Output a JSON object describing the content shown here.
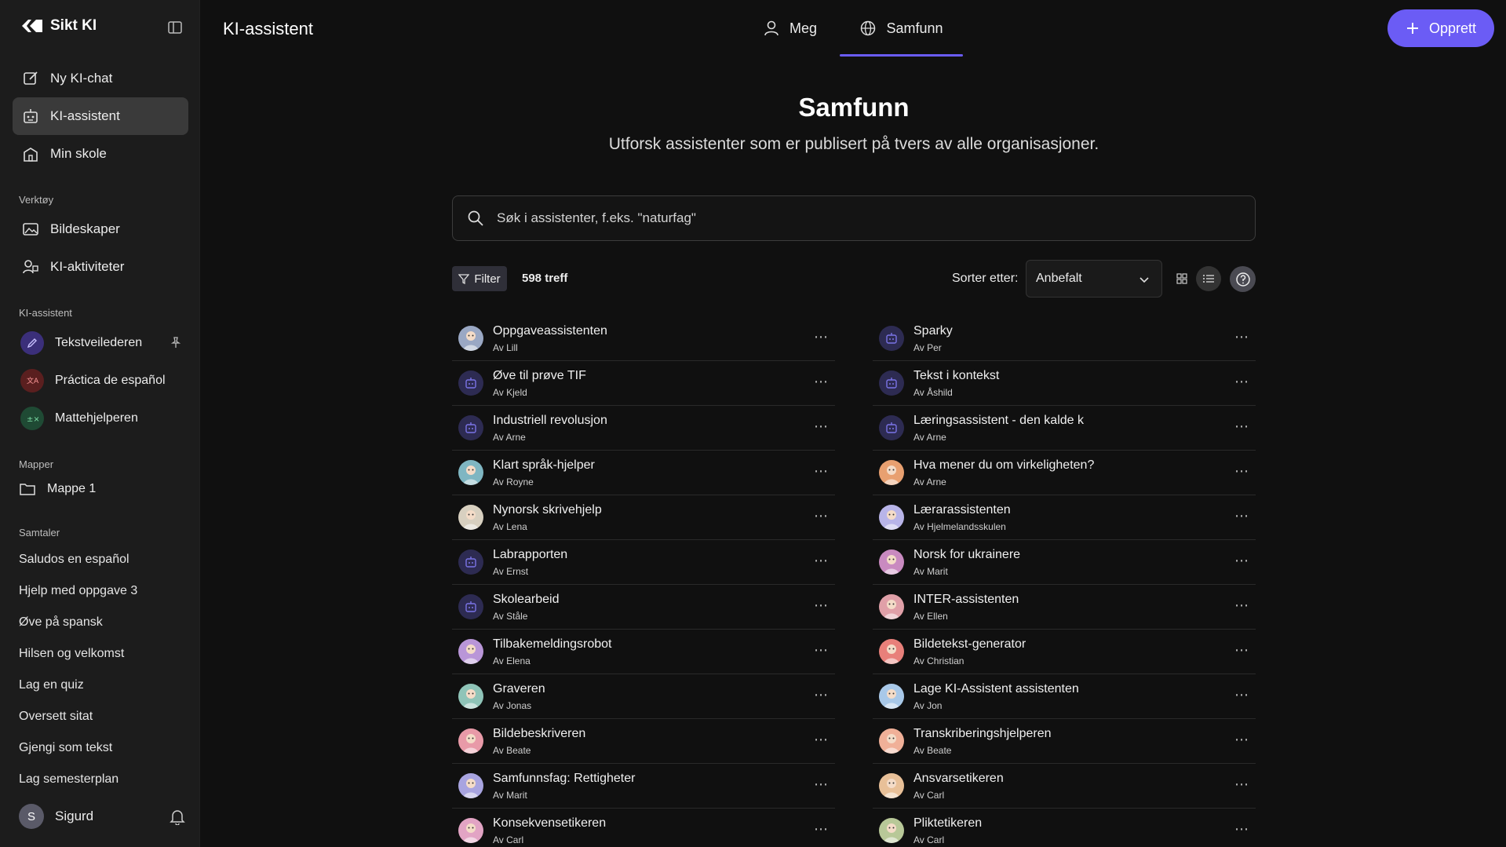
{
  "brand": {
    "name": "Sikt KI"
  },
  "header": {
    "title": "KI-assistent",
    "tabs": [
      {
        "label": "Meg"
      },
      {
        "label": "Samfunn"
      }
    ],
    "create_label": "Opprett"
  },
  "sidebar": {
    "nav": [
      {
        "label": "Ny KI-chat",
        "icon": "edit-icon"
      },
      {
        "label": "KI-assistent",
        "icon": "robot-icon"
      },
      {
        "label": "Min skole",
        "icon": "school-icon"
      }
    ],
    "tools_label": "Verktøy",
    "tools": [
      {
        "label": "Bildeskaper",
        "icon": "image-icon"
      },
      {
        "label": "KI-aktiviteter",
        "icon": "activities-icon"
      }
    ],
    "assistants_label": "KI-assistent",
    "assistants": [
      {
        "label": "Tekstveilederen",
        "color": "#3b2f7a"
      },
      {
        "label": "Práctica de español",
        "color": "#5a1f1f"
      },
      {
        "label": "Mattehjelperen",
        "color": "#1f4a34"
      }
    ],
    "folders_label": "Mapper",
    "folders": [
      {
        "label": "Mappe 1"
      }
    ],
    "chats_label": "Samtaler",
    "chats": [
      "Saludos en español",
      "Hjelp med oppgave 3",
      "Øve på spansk",
      "Hilsen og velkomst",
      "Lag en quiz",
      "Oversett sitat",
      "Gjengi som tekst",
      "Lag semesterplan"
    ],
    "user": {
      "initial": "S",
      "name": "Sigurd"
    }
  },
  "hero": {
    "title": "Samfunn",
    "subtitle": "Utforsk assistenter som er publisert på tvers av alle organisasjoner."
  },
  "search": {
    "placeholder": "Søk i assistenter, f.eks. \"naturfag\""
  },
  "toolbar": {
    "filter_label": "Filter",
    "count": "598 treff",
    "sort_label": "Sorter etter:",
    "sort_value": "Anbefalt"
  },
  "list_left": [
    {
      "title": "Oppgaveassistenten",
      "author": "Av Lill",
      "avatar": "person",
      "color": "#9aa8c4"
    },
    {
      "title": "Øve til prøve TIF",
      "author": "Av Kjeld",
      "avatar": "bot",
      "color": "#7b74e8"
    },
    {
      "title": "Industriell revolusjon",
      "author": "Av Arne",
      "avatar": "bot",
      "color": "#7b74e8"
    },
    {
      "title": "Klart språk-hjelper",
      "author": "Av Royne",
      "avatar": "person",
      "color": "#7fb6c2"
    },
    {
      "title": "Nynorsk skrivehjelp",
      "author": "Av Lena",
      "avatar": "person",
      "color": "#d8d0c0"
    },
    {
      "title": "Labrapporten",
      "author": "Av Ernst",
      "avatar": "bot",
      "color": "#7b74e8"
    },
    {
      "title": "Skolearbeid",
      "author": "Av Ståle",
      "avatar": "bot",
      "color": "#7b74e8"
    },
    {
      "title": "Tilbakemeldingsrobot",
      "author": "Av Elena",
      "avatar": "person",
      "color": "#b996d8"
    },
    {
      "title": "Graveren",
      "author": "Av Jonas",
      "avatar": "person",
      "color": "#8fc4b8"
    },
    {
      "title": "Bildebeskriveren",
      "author": "Av Beate",
      "avatar": "person",
      "color": "#e89aa8"
    },
    {
      "title": "Samfunnsfag: Rettigheter",
      "author": "Av Marit",
      "avatar": "person",
      "color": "#a8a4e0"
    },
    {
      "title": "Konsekvensetikeren",
      "author": "Av Carl",
      "avatar": "person",
      "color": "#e2a4c4"
    }
  ],
  "list_right": [
    {
      "title": "Sparky",
      "author": "Av Per",
      "avatar": "bot",
      "color": "#7b74e8"
    },
    {
      "title": "Tekst i kontekst",
      "author": "Av Åshild",
      "avatar": "bot",
      "color": "#7b74e8"
    },
    {
      "title": "Læringsassistent - den kalde k",
      "author": "Av Arne",
      "avatar": "bot",
      "color": "#7b74e8"
    },
    {
      "title": "Hva mener du om virkeligheten?",
      "author": "Av Arne",
      "avatar": "person",
      "color": "#e8a070"
    },
    {
      "title": "Lærarassistenten",
      "author": "Av Hjelmelandsskulen",
      "avatar": "person",
      "color": "#b8b4e8"
    },
    {
      "title": "Norsk for ukrainere",
      "author": "Av Marit",
      "avatar": "person",
      "color": "#c98ac0"
    },
    {
      "title": "INTER-assistenten",
      "author": "Av Ellen",
      "avatar": "person",
      "color": "#e0a0a8"
    },
    {
      "title": "Bildetekst-generator",
      "author": "Av Christian",
      "avatar": "person",
      "color": "#e8807a"
    },
    {
      "title": "Lage KI-Assistent assistenten",
      "author": "Av Jon",
      "avatar": "person",
      "color": "#a8c8e8"
    },
    {
      "title": "Transkriberingshjelperen",
      "author": "Av Beate",
      "avatar": "person",
      "color": "#f0b098"
    },
    {
      "title": "Ansvarsetikeren",
      "author": "Av Carl",
      "avatar": "person",
      "color": "#e8c098"
    },
    {
      "title": "Pliktetikeren",
      "author": "Av Carl",
      "avatar": "person",
      "color": "#b8c898"
    }
  ]
}
